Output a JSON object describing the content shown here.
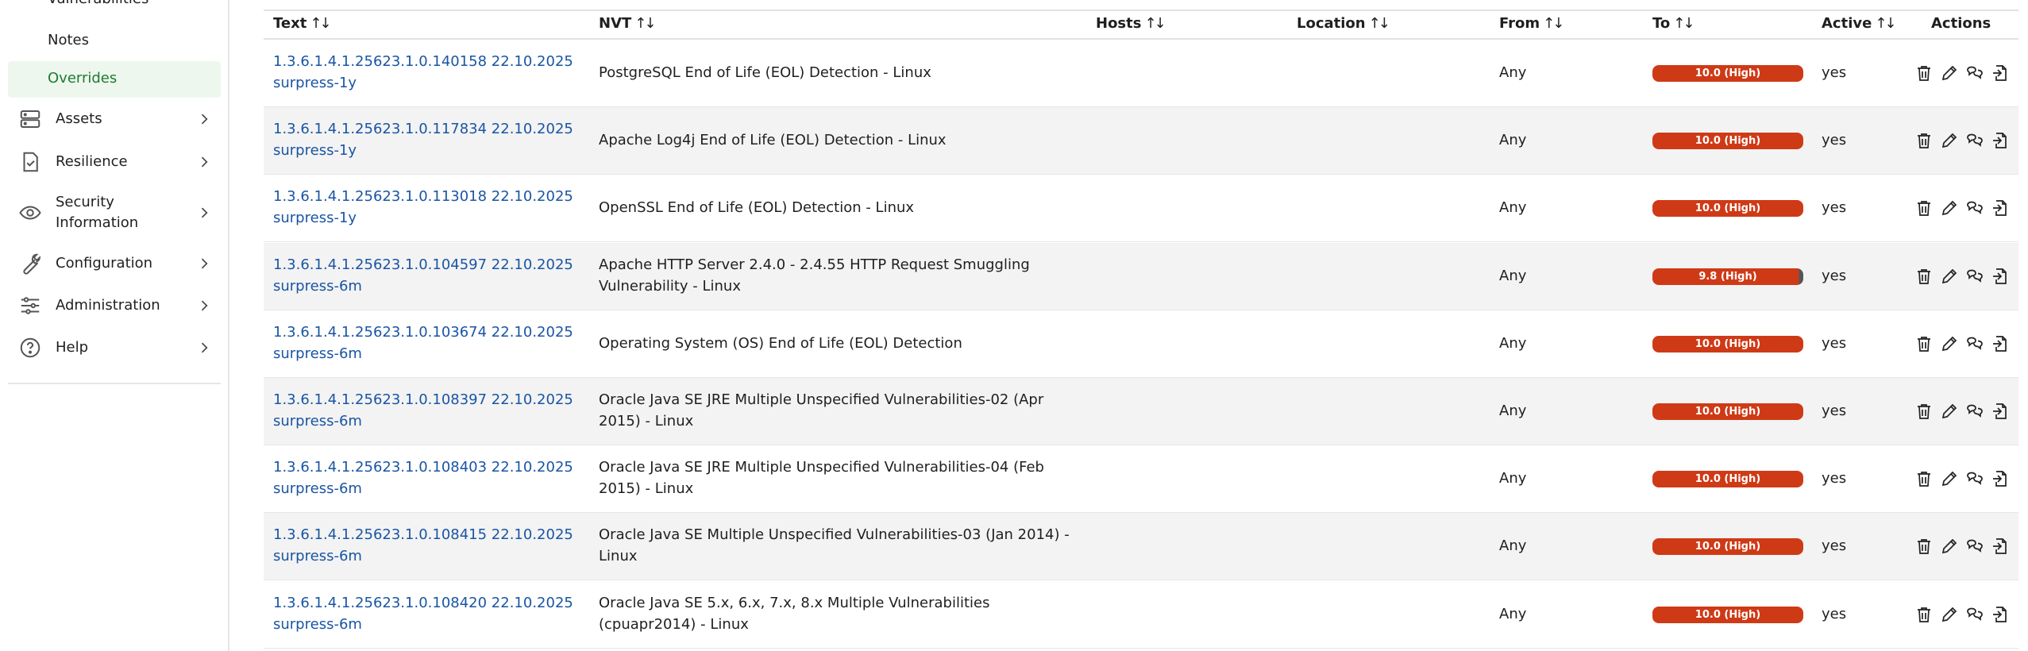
{
  "sidebar": {
    "cut_item": "Vulnerabilities",
    "notes": "Notes",
    "overrides": "Overrides",
    "items": [
      {
        "label": "Assets",
        "icon": "server-icon"
      },
      {
        "label": "Resilience",
        "icon": "clipboard-check-icon"
      },
      {
        "label": "Security Information",
        "icon": "eye-icon"
      },
      {
        "label": "Configuration",
        "icon": "wrench-icon"
      },
      {
        "label": "Administration",
        "icon": "sliders-icon"
      },
      {
        "label": "Help",
        "icon": "help-circle-icon"
      }
    ]
  },
  "table": {
    "headers": {
      "text": "Text",
      "nvt": "NVT",
      "hosts": "Hosts",
      "location": "Location",
      "from": "From",
      "to": "To",
      "active": "Active",
      "actions": "Actions"
    },
    "sort_glyph": "↑↓",
    "rows": [
      {
        "text_line1": "1.3.6.1.4.1.25623.1.0.140158 22.10.2025",
        "text_line2": "surpress-1y",
        "nvt": "PostgreSQL End of Life (EOL) Detection - Linux",
        "from": "Any",
        "to": "10.0 (High)",
        "active": "yes"
      },
      {
        "text_line1": "1.3.6.1.4.1.25623.1.0.117834 22.10.2025",
        "text_line2": "surpress-1y",
        "nvt": "Apache Log4j End of Life (EOL) Detection - Linux",
        "from": "Any",
        "to": "10.0 (High)",
        "active": "yes"
      },
      {
        "text_line1": "1.3.6.1.4.1.25623.1.0.113018 22.10.2025",
        "text_line2": "surpress-1y",
        "nvt": "OpenSSL End of Life (EOL) Detection - Linux",
        "from": "Any",
        "to": "10.0 (High)",
        "active": "yes"
      },
      {
        "text_line1": "1.3.6.1.4.1.25623.1.0.104597 22.10.2025",
        "text_line2": "surpress-6m",
        "nvt": "Apache HTTP Server 2.4.0 - 2.4.55 HTTP Request Smuggling Vulnerability - Linux",
        "from": "Any",
        "to": "9.8 (High)",
        "active": "yes"
      },
      {
        "text_line1": "1.3.6.1.4.1.25623.1.0.103674 22.10.2025",
        "text_line2": "surpress-6m",
        "nvt": "Operating System (OS) End of Life (EOL) Detection",
        "from": "Any",
        "to": "10.0 (High)",
        "active": "yes"
      },
      {
        "text_line1": "1.3.6.1.4.1.25623.1.0.108397 22.10.2025",
        "text_line2": "surpress-6m",
        "nvt": "Oracle Java SE JRE Multiple Unspecified Vulnerabilities-02 (Apr 2015) - Linux",
        "from": "Any",
        "to": "10.0 (High)",
        "active": "yes"
      },
      {
        "text_line1": "1.3.6.1.4.1.25623.1.0.108403 22.10.2025",
        "text_line2": "surpress-6m",
        "nvt": "Oracle Java SE JRE Multiple Unspecified Vulnerabilities-04 (Feb 2015) - Linux",
        "from": "Any",
        "to": "10.0 (High)",
        "active": "yes"
      },
      {
        "text_line1": "1.3.6.1.4.1.25623.1.0.108415 22.10.2025",
        "text_line2": "surpress-6m",
        "nvt": "Oracle Java SE Multiple Unspecified Vulnerabilities-03 (Jan 2014) - Linux",
        "from": "Any",
        "to": "10.0 (High)",
        "active": "yes"
      },
      {
        "text_line1": "1.3.6.1.4.1.25623.1.0.108420 22.10.2025",
        "text_line2": "surpress-6m",
        "nvt": "Oracle Java SE 5.x, 6.x, 7.x, 8.x Multiple Vulnerabilities (cpuapr2014) - Linux",
        "from": "Any",
        "to": "10.0 (High)",
        "active": "yes"
      }
    ]
  },
  "colors": {
    "link": "#1a55a3",
    "severity_high": "#cf3a16",
    "active_nav": "#1e7b30",
    "row_alt": "#f3f3f3"
  }
}
